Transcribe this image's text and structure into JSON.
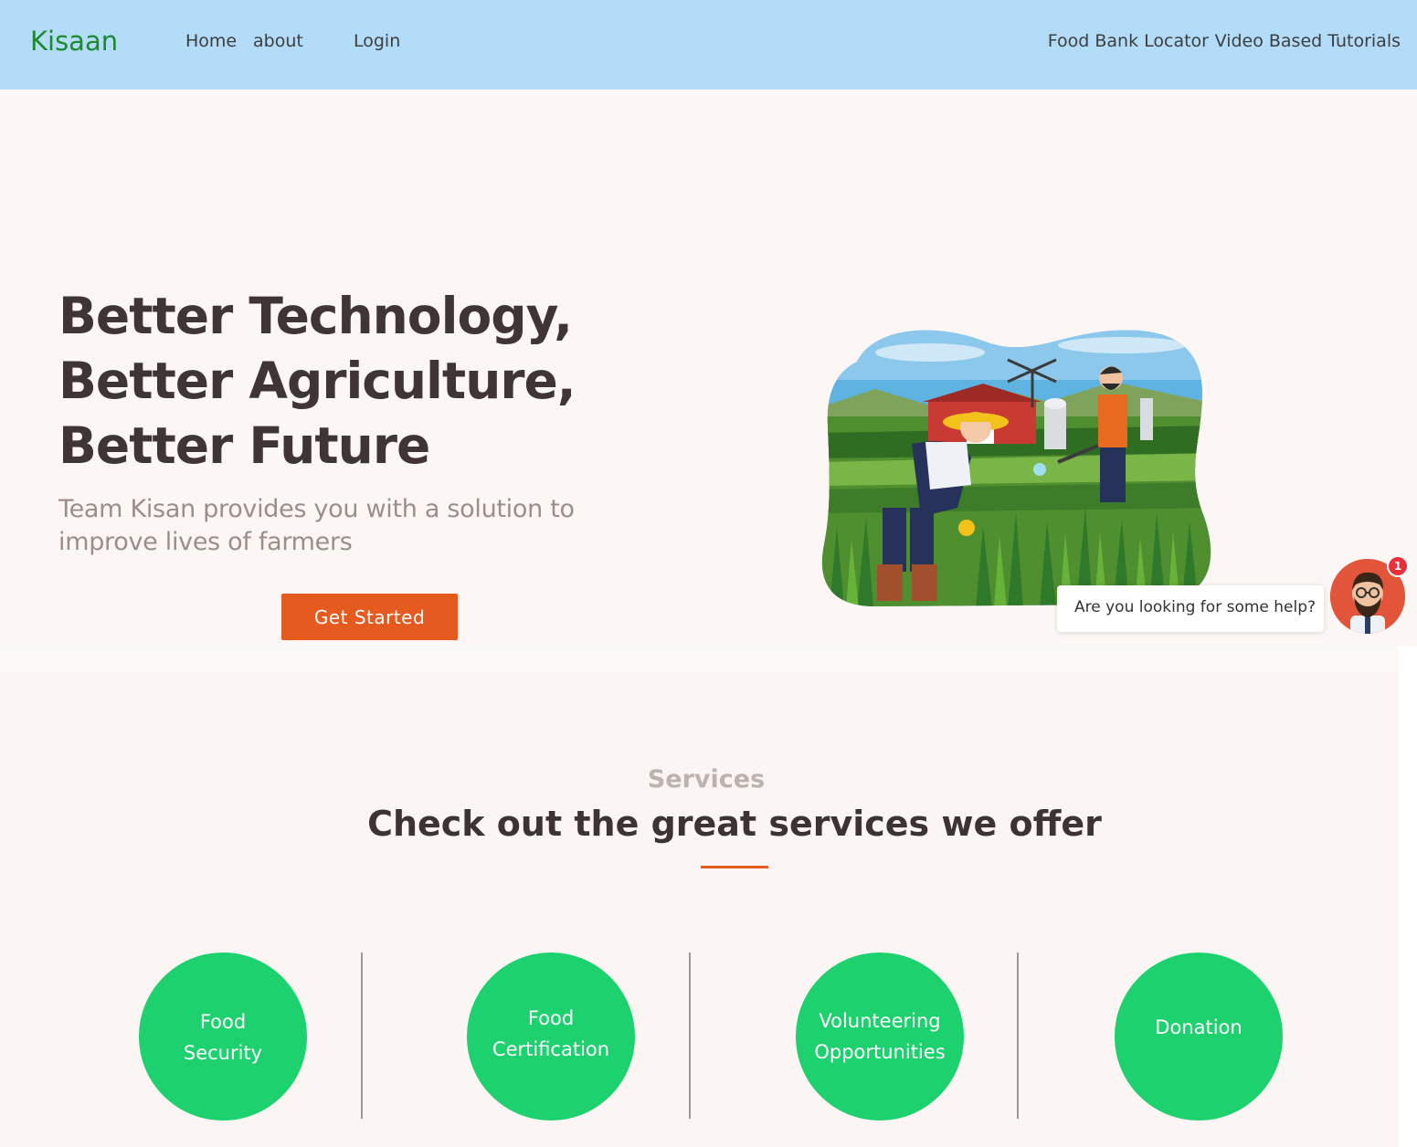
{
  "header": {
    "brand": "Kisaan",
    "nav_left": [
      "Home",
      "about",
      "Login"
    ],
    "nav_right": [
      "Food Bank Locator",
      "Video Based Tutorials"
    ]
  },
  "hero": {
    "title_lines": [
      "Better Technology,",
      "Better Agriculture,",
      "Better Future"
    ],
    "subtitle": "Team Kisan provides you with a solution to improve lives of farmers",
    "cta_label": "Get Started"
  },
  "chat": {
    "prompt": "Are you looking for some help?",
    "badge_count": "1"
  },
  "services": {
    "label": "Services",
    "heading": "Check out the great services we offer",
    "items": [
      "Food Security",
      "Food Certification",
      "Volunteering Opportunities",
      "Donation"
    ]
  },
  "colors": {
    "nav_background": "#b2dcf8",
    "brand": "#1c8a2e",
    "accent": "#e55a1f",
    "service_circle": "#1dd16f"
  }
}
